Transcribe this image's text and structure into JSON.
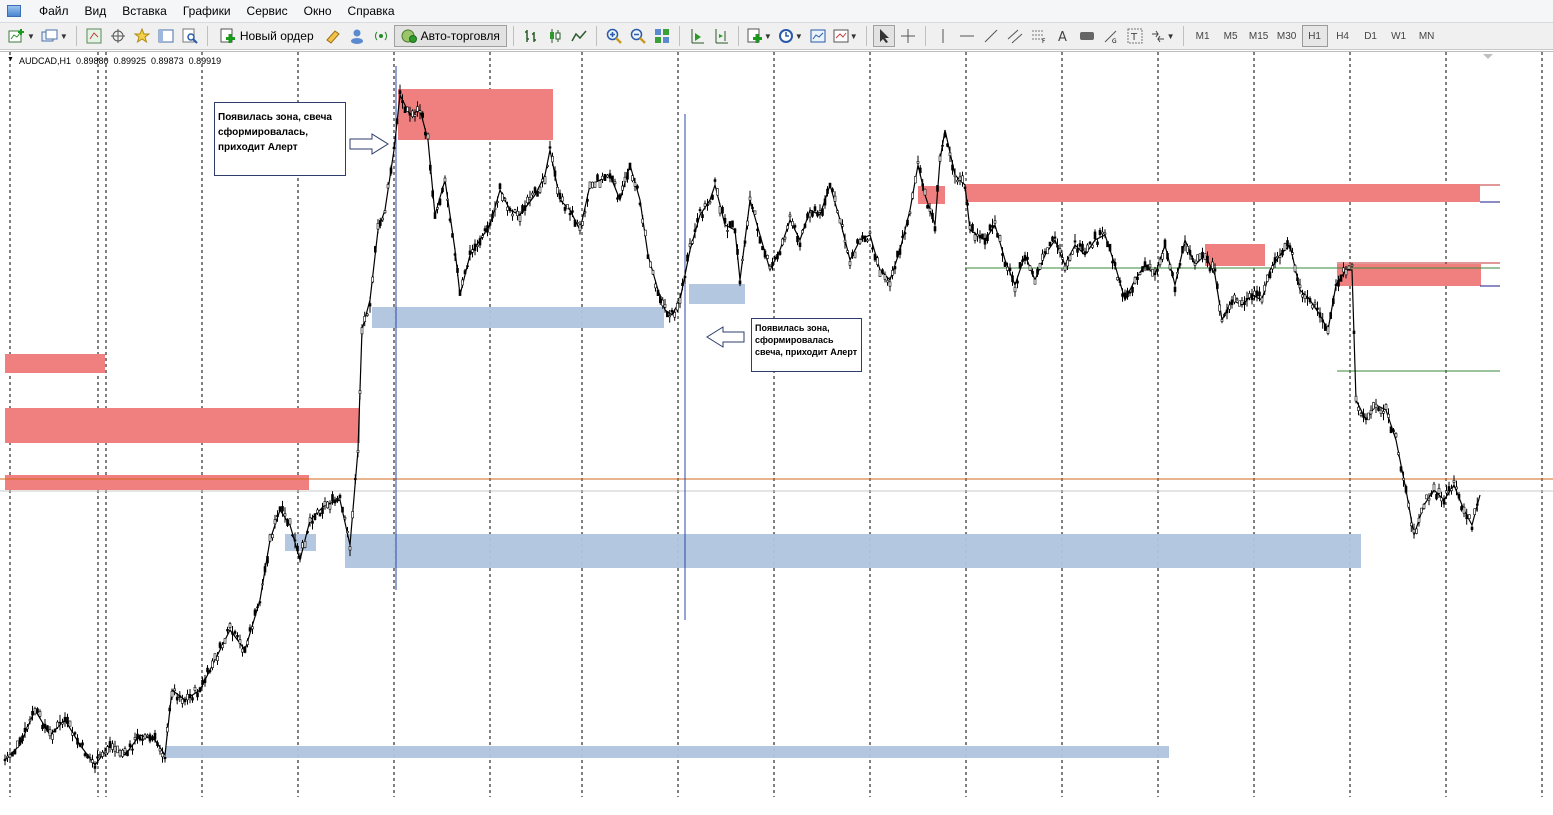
{
  "menu": [
    "Файл",
    "Вид",
    "Вставка",
    "Графики",
    "Сервис",
    "Окно",
    "Справка"
  ],
  "toolbar": {
    "new_order": "Новый ордер",
    "autotrading": "Авто-торговля",
    "timeframes": [
      "M1",
      "M5",
      "M15",
      "M30",
      "H1",
      "H4",
      "D1",
      "W1",
      "MN"
    ],
    "active_timeframe": "H1"
  },
  "chart": {
    "symbol": "AUDCAD,H1",
    "open": "0.89880",
    "high": "0.89925",
    "low": "0.89873",
    "close": "0.89919"
  },
  "annotations": {
    "note1": "Появилась зона, свеча сформировалась, приходит Алерт",
    "note2": "Появилась зона, сформировалась свеча, приходит Алерт"
  },
  "colors": {
    "supply_zone": "#f08080",
    "demand_zone": "#b0c4de",
    "candle": "#000000",
    "current_price_line": "#d2691e",
    "level_green": "#3a8a3a",
    "level_navy": "#1a1a8a",
    "marker_line": "#2a4aa8"
  }
}
